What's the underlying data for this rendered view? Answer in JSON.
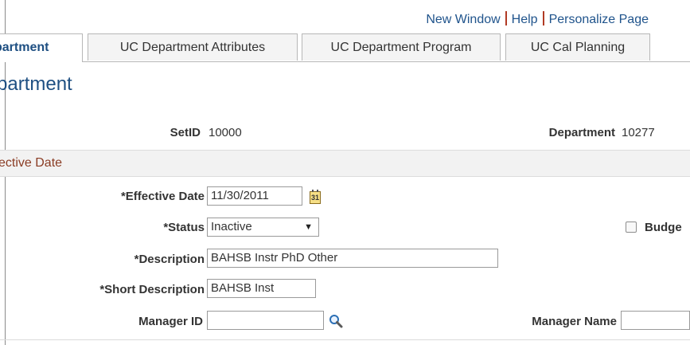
{
  "header_links": {
    "new_window": "New Window",
    "help": "Help",
    "personalize_page": "Personalize Page"
  },
  "tabs": [
    {
      "label": "partment",
      "active": true
    },
    {
      "label": "UC Department Attributes",
      "active": false
    },
    {
      "label": "UC Department Program",
      "active": false
    },
    {
      "label": "UC Cal Planning",
      "active": false
    }
  ],
  "page_title": "partment",
  "setid": {
    "label": "SetID",
    "value": "10000"
  },
  "department": {
    "label": "Department",
    "value": "10277"
  },
  "section_title": "ective Date",
  "effective_date": {
    "label": "*Effective Date",
    "value": "11/30/2011",
    "calendar_glyph": "31"
  },
  "status": {
    "label": "*Status",
    "value": "Inactive"
  },
  "budget_checkbox": {
    "label": "Budge",
    "checked": false
  },
  "description": {
    "label": "*Description",
    "value": "BAHSB Instr PhD Other"
  },
  "short_description": {
    "label": "*Short Description",
    "value": "BAHSB Inst"
  },
  "manager_id": {
    "label": "Manager ID",
    "value": ""
  },
  "manager_name": {
    "label": "Manager Name",
    "value": ""
  },
  "icons": {
    "calendar": "calendar-icon",
    "lookup": "magnifier-lookup-icon",
    "dropdown": "triangle-down"
  },
  "colors": {
    "link": "#20548c",
    "title": "#1e4f82",
    "section_title": "#8a3c24",
    "separator": "#b13a24"
  }
}
